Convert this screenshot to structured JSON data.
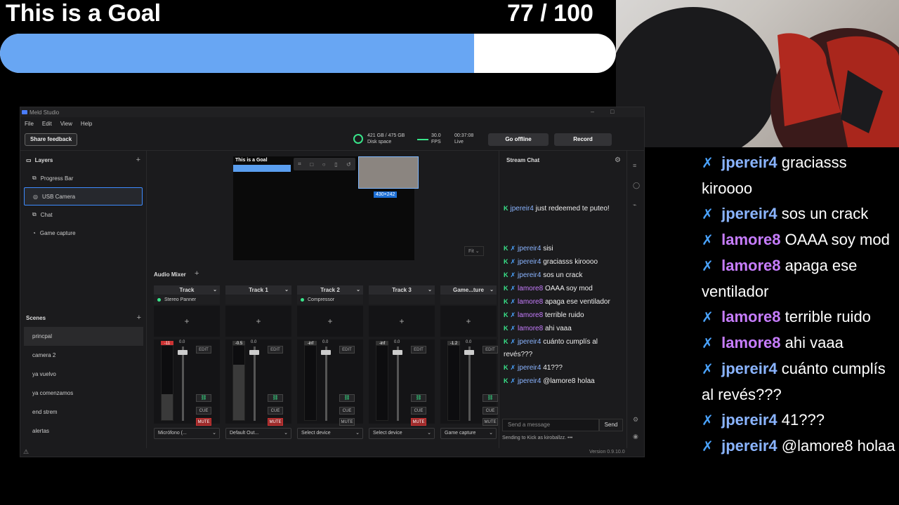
{
  "overlay": {
    "goal_title": "This is a Goal",
    "goal_count": "77 / 100",
    "goal_progress": 0.77,
    "big_chat": [
      {
        "user": "jpereir4",
        "kind": "j",
        "text": "graciasss kiroooo"
      },
      {
        "user": "jpereir4",
        "kind": "j",
        "text": "sos un crack"
      },
      {
        "user": "lamore8",
        "kind": "l",
        "text": "OAAA soy mod"
      },
      {
        "user": "lamore8",
        "kind": "l",
        "text": "apaga ese ventilador"
      },
      {
        "user": "lamore8",
        "kind": "l",
        "text": "terrible ruido"
      },
      {
        "user": "lamore8",
        "kind": "l",
        "text": "ahi vaaa"
      },
      {
        "user": "jpereir4",
        "kind": "j",
        "text": "cuánto cumplís al revés???"
      },
      {
        "user": "jpereir4",
        "kind": "j",
        "text": "41???"
      },
      {
        "user": "jpereir4",
        "kind": "j",
        "text": "@lamore8 holaa"
      }
    ]
  },
  "app": {
    "title": "Meld Studio",
    "menu": [
      "File",
      "Edit",
      "View",
      "Help"
    ],
    "feedback_label": "Share feedback",
    "disk_value": "421 GB / 475 GB",
    "disk_label": "Disk space",
    "fps_value": "30.0",
    "fps_label": "FPS",
    "timer_value": "00:37:08",
    "timer_label": "Live",
    "go_offline_label": "Go offline",
    "record_label": "Record",
    "version": "Version 0.9.10.0"
  },
  "layers": {
    "title": "Layers",
    "items": [
      {
        "label": "Progress Bar",
        "selected": false
      },
      {
        "label": "USB Camera",
        "selected": true
      },
      {
        "label": "Chat",
        "selected": false
      },
      {
        "label": "Game capture",
        "selected": false
      }
    ]
  },
  "scenes": {
    "title": "Scenes",
    "items": [
      "princpal",
      "camera 2",
      "ya vuelvo",
      "ya comenzamos",
      "end strem",
      "alertas"
    ]
  },
  "preview": {
    "title": "This is a Goal",
    "size_badge": "430×242",
    "fit_label": "Fit"
  },
  "mixer": {
    "title": "Audio Mixer",
    "tracks": [
      {
        "name": "Track",
        "filter": "Stereo Panner",
        "peak": "-11",
        "value": "0.0",
        "level": 0.35,
        "knob": 0.05,
        "muted": true,
        "device": "Micrófono (..."
      },
      {
        "name": "Track 1",
        "filter": "",
        "peak": "-0.5",
        "value": "0.0",
        "level": 0.75,
        "knob": 0.05,
        "muted": true,
        "device": "Default Out..."
      },
      {
        "name": "Track 2",
        "filter": "Compressor",
        "peak": "-inf",
        "value": "0.0",
        "level": 0.0,
        "knob": 0.05,
        "muted": false,
        "device": "Select device"
      },
      {
        "name": "Track 3",
        "filter": "",
        "peak": "-inf",
        "value": "0.0",
        "level": 0.0,
        "knob": 0.05,
        "muted": true,
        "device": "Select device"
      },
      {
        "name": "Game...ture",
        "filter": "",
        "peak": "-1.2",
        "value": "0.0",
        "level": 0.0,
        "knob": 0.05,
        "muted": false,
        "device": "Game capture"
      }
    ]
  },
  "stream_chat": {
    "title": "Stream Chat",
    "pinned_user": "jpereir4",
    "pinned_text": "just redeemed  te puteo!",
    "messages": [
      {
        "user": "jpereir4",
        "kind": "j",
        "text": "sisi"
      },
      {
        "user": "jpereir4",
        "kind": "j",
        "text": "graciasss kiroooo"
      },
      {
        "user": "jpereir4",
        "kind": "j",
        "text": "sos un crack"
      },
      {
        "user": "lamore8",
        "kind": "l",
        "text": "OAAA soy mod"
      },
      {
        "user": "lamore8",
        "kind": "l",
        "text": "apaga ese ventilador"
      },
      {
        "user": "lamore8",
        "kind": "l",
        "text": "terrible ruido"
      },
      {
        "user": "lamore8",
        "kind": "l",
        "text": "ahi vaaa"
      },
      {
        "user": "jpereir4",
        "kind": "j",
        "text": "cuánto cumplís al revés???"
      },
      {
        "user": "jpereir4",
        "kind": "j",
        "text": "41???"
      },
      {
        "user": "jpereir4",
        "kind": "j",
        "text": "@lamore8 holaa"
      }
    ],
    "input_placeholder": "Send a message",
    "send_label": "Send",
    "sending_as": "Sending to Kick as kiroballzz."
  }
}
